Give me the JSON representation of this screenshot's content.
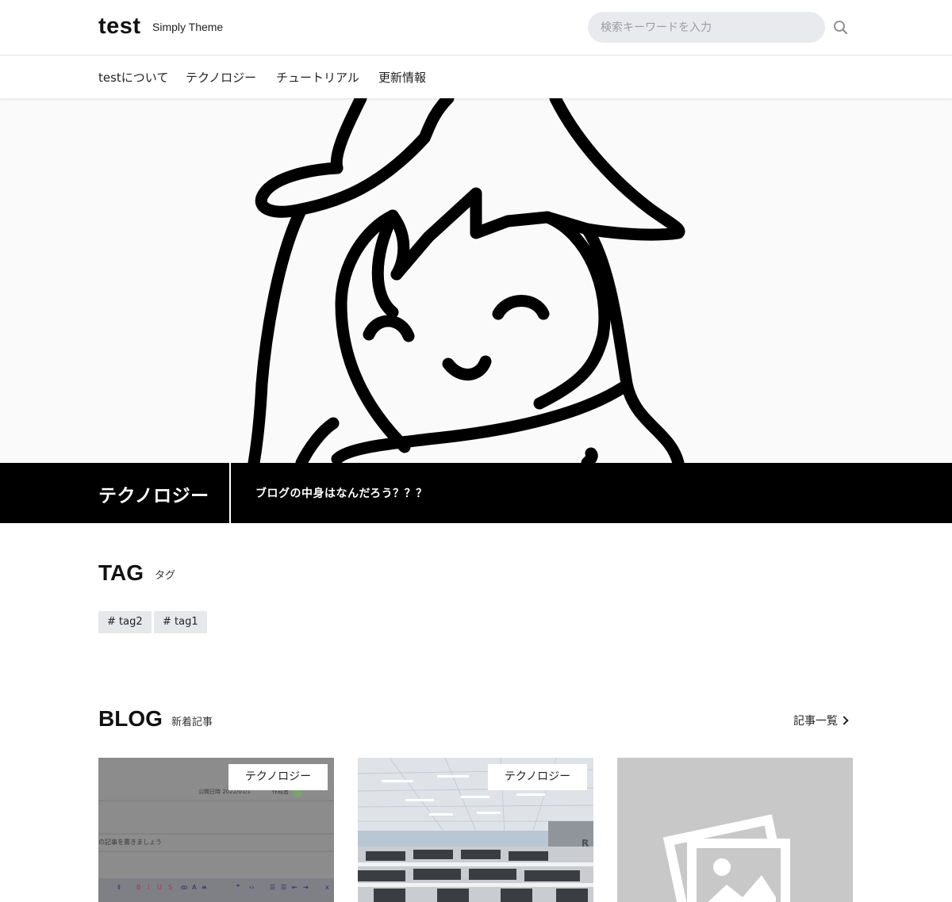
{
  "header": {
    "site_title": "test",
    "tagline": "Simply Theme",
    "search_placeholder": "検索キーワードを入力",
    "search_icon": "search-icon"
  },
  "nav": {
    "items": [
      {
        "label": "testについて"
      },
      {
        "label": "テクノロジー"
      },
      {
        "label": "チュートリアル"
      },
      {
        "label": "更新情報"
      }
    ]
  },
  "category_band": {
    "title": "テクノロジー",
    "description": "ブログの中身はなんだろう？？？"
  },
  "tag_section": {
    "title": "TAG",
    "subtitle": "タグ",
    "tags": [
      "# tag2",
      "# tag1"
    ]
  },
  "blog_section": {
    "title": "BLOG",
    "subtitle": "新着記事",
    "archive_label": "記事一覧",
    "cards": [
      {
        "category": "テクノロジー",
        "thumb_date": "公開日時 2022/01/1",
        "thumb_author": "作成者",
        "thumb_text": "の記事を書きましょう"
      },
      {
        "category": "テクノロジー"
      },
      {
        "category": ""
      }
    ]
  },
  "colors": {
    "band_bg": "#000000",
    "tag_bg": "#e6e8ec",
    "search_bg": "#e8eaee",
    "placeholder_bg": "#c8c8c8"
  }
}
